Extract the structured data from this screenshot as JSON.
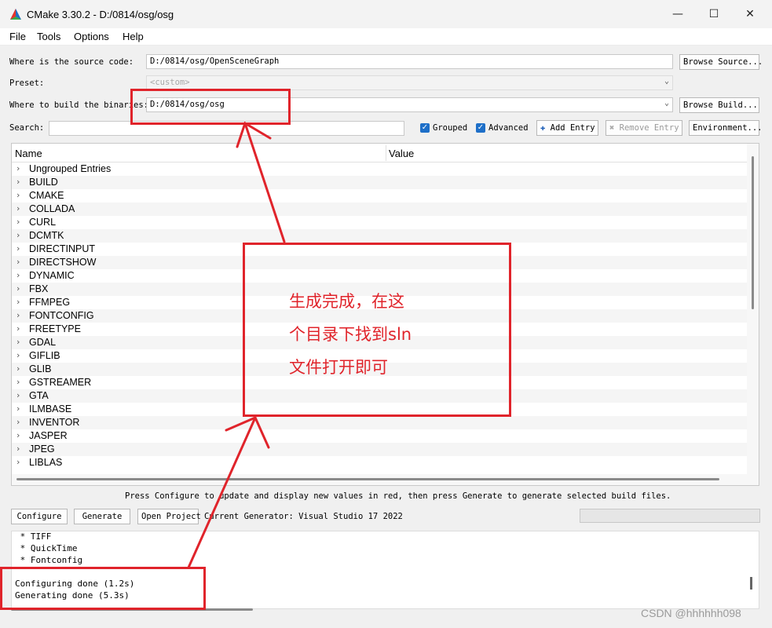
{
  "window": {
    "title": "CMake 3.30.2 - D:/0814/osg/osg",
    "controls": {
      "minimize": "—",
      "maximize": "☐",
      "close": "✕"
    }
  },
  "menu": [
    "File",
    "Tools",
    "Options",
    "Help"
  ],
  "source": {
    "label": "Where is the source code:",
    "value": "D:/0814/osg/OpenSceneGraph",
    "browse_label": "Browse Source..."
  },
  "preset": {
    "label": "Preset:",
    "value": "<custom>"
  },
  "binaries": {
    "label": "Where to build the binaries:",
    "value": "D:/0814/osg/osg",
    "browse_label": "Browse Build..."
  },
  "search": {
    "label": "Search:",
    "value": ""
  },
  "options": {
    "grouped": {
      "label": "Grouped",
      "checked": true
    },
    "advanced": {
      "label": "Advanced",
      "checked": true
    },
    "add_entry": "Add Entry",
    "remove_entry": "Remove Entry",
    "environment": "Environment..."
  },
  "tree": {
    "columns": [
      "Name",
      "Value"
    ],
    "rows": [
      "Ungrouped Entries",
      "BUILD",
      "CMAKE",
      "COLLADA",
      "CURL",
      "DCMTK",
      "DIRECTINPUT",
      "DIRECTSHOW",
      "DYNAMIC",
      "FBX",
      "FFMPEG",
      "FONTCONFIG",
      "FREETYPE",
      "GDAL",
      "GIFLIB",
      "GLIB",
      "GSTREAMER",
      "GTA",
      "ILMBASE",
      "INVENTOR",
      "JASPER",
      "JPEG",
      "LIBLAS"
    ]
  },
  "hint": "Press Configure to update and display new values in red, then press Generate to generate selected build files.",
  "actions": {
    "configure": "Configure",
    "generate": "Generate",
    "open_project": "Open Project",
    "generator": "Current Generator: Visual Studio 17 2022"
  },
  "output": {
    "lines": [
      " * TIFF",
      " * QuickTime",
      " * Fontconfig",
      "",
      "Configuring done (1.2s)",
      "Generating done (5.3s)"
    ]
  },
  "annotation": {
    "lines": [
      "生成完成，在这",
      "个目录下找到sln",
      "文件打开即可"
    ],
    "color": "#e0242b"
  },
  "watermark": "CSDN @hhhhhh098"
}
